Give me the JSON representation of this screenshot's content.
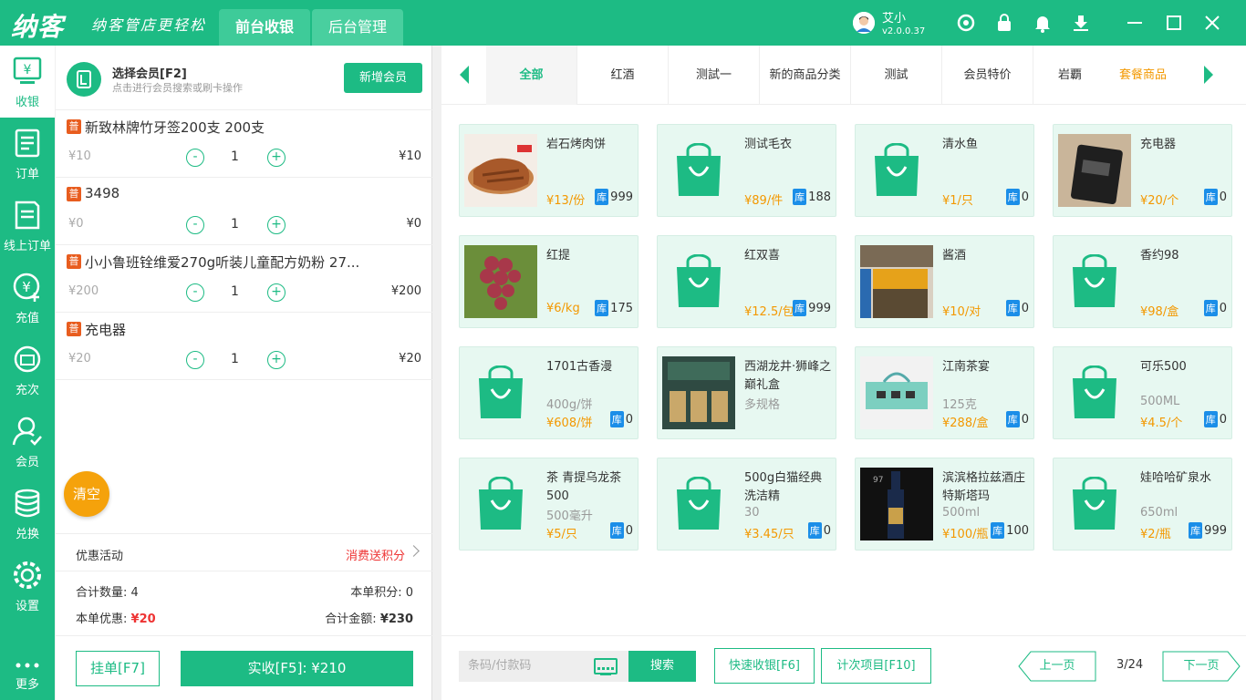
{
  "app": {
    "logo": "纳客",
    "slogan": "纳客管店更轻松",
    "tabs": [
      "前台收银",
      "后台管理"
    ],
    "user_name": "艾小",
    "version": "v2.0.0.37"
  },
  "sidebar": {
    "items": [
      "收银",
      "订单",
      "线上订单",
      "充值",
      "充次",
      "会员",
      "兑换",
      "设置",
      "更多"
    ]
  },
  "member": {
    "title": "选择会员[F2]",
    "subtitle": "点击进行会员搜索或刷卡操作",
    "add_button": "新增会员"
  },
  "cart": {
    "items": [
      {
        "badge": "普",
        "name": "新致林牌竹牙签200支 200支",
        "price": "¥10",
        "qty": "1",
        "subtotal": "¥10"
      },
      {
        "badge": "普",
        "name": "3498",
        "price": "¥0",
        "qty": "1",
        "subtotal": "¥0"
      },
      {
        "badge": "普",
        "name": "小小鲁班铨维爱270g听装儿童配方奶粉 27...",
        "price": "¥200",
        "qty": "1",
        "subtotal": "¥200"
      },
      {
        "badge": "普",
        "name": "充电器",
        "price": "¥20",
        "qty": "1",
        "subtotal": "¥20"
      }
    ],
    "minus": "-",
    "plus": "+",
    "clear_button": "清空"
  },
  "promo": {
    "label": "优惠活动",
    "value": "消费送积分"
  },
  "summary": {
    "count_label": "合计数量:",
    "count": "4",
    "points_label": "本单积分:",
    "points": "0",
    "discount_label": "本单优惠:",
    "discount": "¥20",
    "total_label": "合计金额:",
    "total": "¥230"
  },
  "actions": {
    "hold": "挂单[F7]",
    "pay": "实收[F5]:  ¥210"
  },
  "categories": [
    "全部",
    "红酒",
    "测試一",
    "新的商品分类",
    "测試",
    "会员特价",
    "岩覇",
    "套餐商品"
  ],
  "stock_label": "库",
  "products": [
    {
      "name": "岩石烤肉饼",
      "spec": "",
      "price": "¥13/份",
      "stock": "999",
      "img": "photo-food"
    },
    {
      "name": "测试毛衣",
      "spec": "",
      "price": "¥89/件",
      "stock": "188",
      "img": "bag"
    },
    {
      "name": "清水鱼",
      "spec": "",
      "price": "¥1/只",
      "stock": "0",
      "img": "bag"
    },
    {
      "name": "充电器",
      "spec": "",
      "price": "¥20/个",
      "stock": "0",
      "img": "photo-charger"
    },
    {
      "name": "红提",
      "spec": "",
      "price": "¥6/kg",
      "stock": "175",
      "img": "photo-grapes"
    },
    {
      "name": "红双喜",
      "spec": "",
      "price": "¥12.5/包",
      "stock": "999",
      "img": "bag"
    },
    {
      "name": "酱酒",
      "spec": "",
      "price": "¥10/对",
      "stock": "0",
      "img": "photo-store"
    },
    {
      "name": "香约98",
      "spec": "",
      "price": "¥98/盒",
      "stock": "0",
      "img": "bag"
    },
    {
      "name": "1701古香漫",
      "spec": "400g/饼",
      "price": "¥608/饼",
      "stock": "0",
      "img": "bag"
    },
    {
      "name": "西湖龙井·狮峰之巅礼盒",
      "spec": "多规格",
      "price": "",
      "stock": "",
      "img": "photo-tea"
    },
    {
      "name": "江南茶宴",
      "spec": "125克",
      "price": "¥288/盒",
      "stock": "0",
      "img": "photo-teabox"
    },
    {
      "name": "可乐500",
      "spec": "500ML",
      "price": "¥4.5/个",
      "stock": "0",
      "img": "bag"
    },
    {
      "name": "茶 青提乌龙茶500",
      "spec": "500毫升",
      "price": "¥5/只",
      "stock": "0",
      "img": "bag"
    },
    {
      "name": "500g白猫经典洗洁精",
      "spec": "30",
      "price": "¥3.45/只",
      "stock": "0",
      "img": "bag"
    },
    {
      "name": "滨滨格拉兹酒庄特斯塔玛",
      "spec": "500ml",
      "price": "¥100/瓶",
      "stock": "100",
      "img": "photo-wine"
    },
    {
      "name": "娃哈哈矿泉水",
      "spec": "650ml",
      "price": "¥2/瓶",
      "stock": "999",
      "img": "bag"
    }
  ],
  "bottom": {
    "barcode_placeholder": "条码/付款码",
    "search": "搜索",
    "quick": "快速收银[F6]",
    "count_items": "计次项目[F10]",
    "prev": "上一页",
    "page": "3/24",
    "next": "下一页"
  },
  "colors": {
    "primary": "#1dbb84",
    "accent": "#f39800",
    "danger": "#e33333"
  }
}
